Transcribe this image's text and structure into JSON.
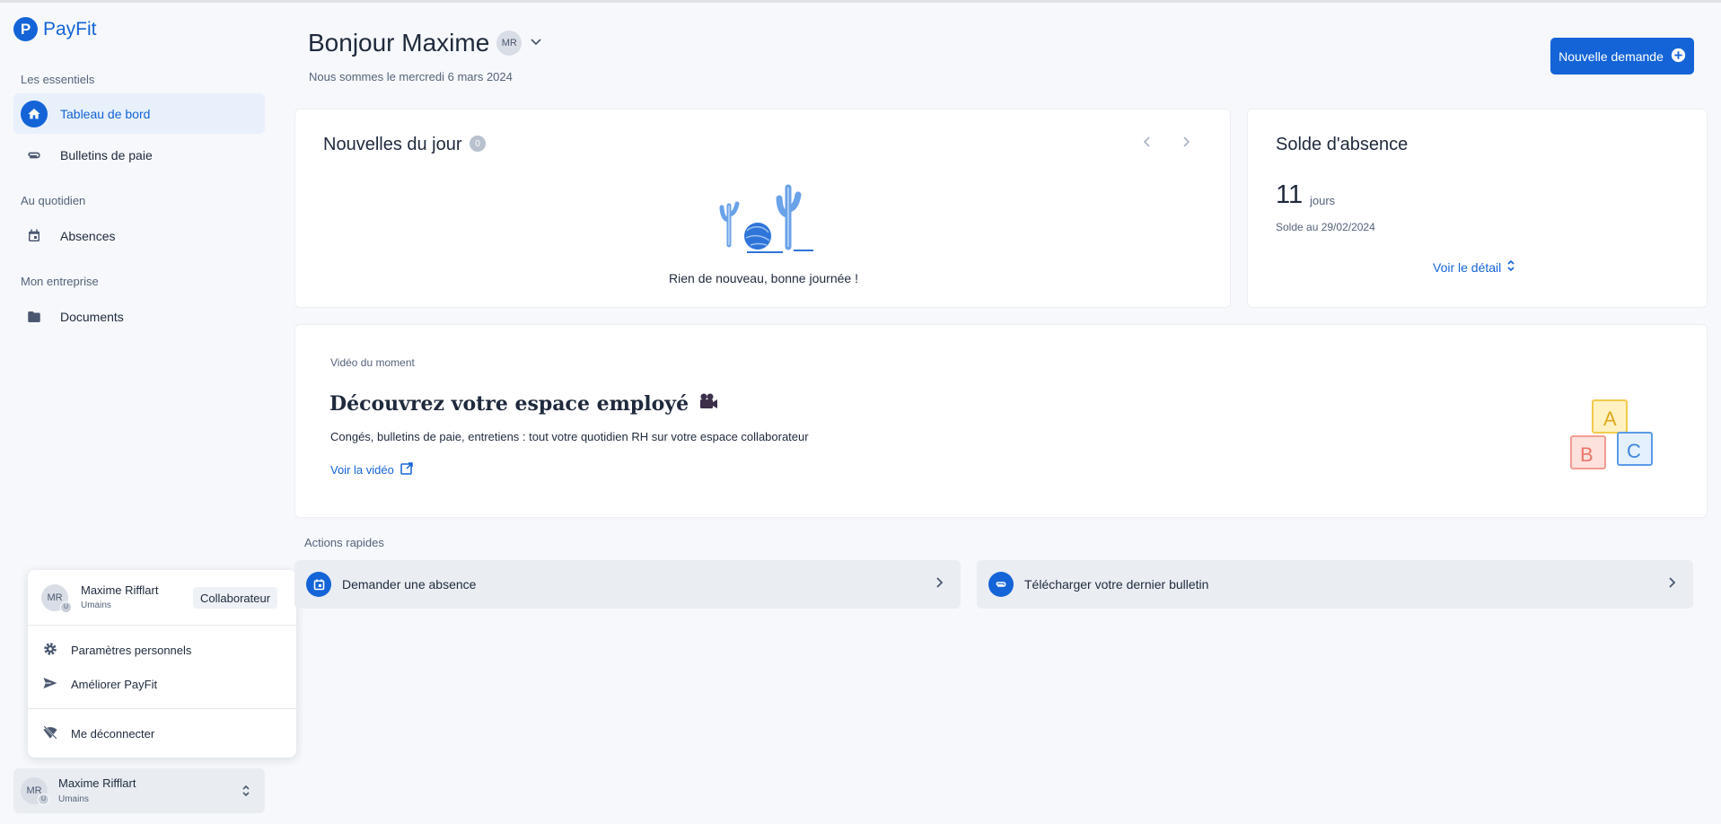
{
  "brand": {
    "name": "PayFit",
    "logo_letter": "P",
    "accent": "#1464d8"
  },
  "sidebar": {
    "sections": [
      {
        "label": "Les essentiels"
      },
      {
        "label": "Au quotidien"
      },
      {
        "label": "Mon entreprise"
      }
    ],
    "items": [
      {
        "label": "Tableau de bord",
        "icon": "home-icon",
        "active": true
      },
      {
        "label": "Bulletins de paie",
        "icon": "paperclip-icon"
      },
      {
        "label": "Absences",
        "icon": "calendar-icon"
      },
      {
        "label": "Documents",
        "icon": "folder-icon"
      }
    ]
  },
  "user_menu": {
    "initials": "MR",
    "badge": "U",
    "name": "Maxime Rifflart",
    "org": "Umains",
    "role": "Collaborateur",
    "items": [
      {
        "label": "Paramètres personnels",
        "icon": "gear-icon"
      },
      {
        "label": "Améliorer PayFit",
        "icon": "send-icon"
      },
      {
        "label": "Me déconnecter",
        "icon": "wifi-off-icon"
      }
    ]
  },
  "user_box": {
    "initials": "MR",
    "badge": "U",
    "name": "Maxime Rifflart",
    "org": "Umains"
  },
  "header": {
    "greeting": "Bonjour Maxime",
    "avatar_initials": "MR",
    "date": "Nous sommes le mercredi 6 mars 2024",
    "primary_button": "Nouvelle demande"
  },
  "news": {
    "title": "Nouvelles du jour",
    "count": "0",
    "empty_text": "Rien de nouveau, bonne journée !"
  },
  "absence": {
    "title": "Solde d'absence",
    "value": "11",
    "unit": "jours",
    "note": "Solde au 29/02/2024",
    "link": "Voir le détail"
  },
  "video": {
    "eyebrow": "Vidéo du moment",
    "title": "Découvrez votre espace employé",
    "description": "Congés, bulletins de paie, entretiens : tout votre quotidien RH sur votre espace collaborateur",
    "link": "Voir la vidéo",
    "blocks": [
      "A",
      "B",
      "C"
    ]
  },
  "quick_actions": {
    "label": "Actions rapides",
    "items": [
      {
        "label": "Demander une absence",
        "icon": "calendar-icon"
      },
      {
        "label": "Télécharger votre dernier bulletin",
        "icon": "paperclip-icon"
      }
    ]
  }
}
